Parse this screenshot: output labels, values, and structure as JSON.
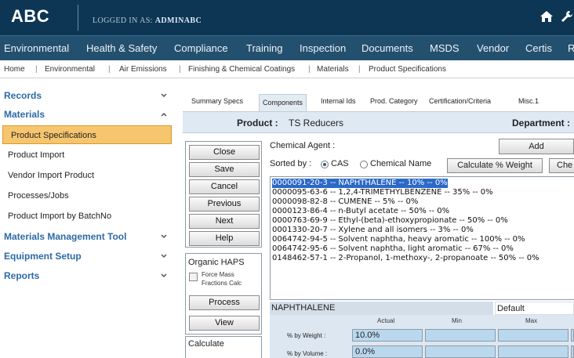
{
  "header": {
    "logo": "ABC",
    "logged_label": "LOGGED IN AS:",
    "logged_user": "ADMINABC"
  },
  "mainnav": {
    "items": [
      "Environmental",
      "Health & Safety",
      "Compliance",
      "Training",
      "Inspection",
      "Documents",
      "MSDS",
      "Vendor",
      "Certis",
      "R"
    ]
  },
  "breadcrumb": {
    "items": [
      "Home",
      "Environmental",
      "Air Emissions",
      "Finishing & Chemical Coatings",
      "Materials",
      "Product Specifications"
    ],
    "separator": "|"
  },
  "sidebar": {
    "records": "Records",
    "materials": "Materials",
    "sub_items": [
      "Product Specifications",
      "Product Import",
      "Vendor Import Product",
      "Processes/Jobs",
      "Product Import by BatchNo"
    ],
    "materials_mgmt": "Materials Management Tool",
    "equipment": "Equipment Setup",
    "reports": "Reports"
  },
  "tabs": [
    "Summary Specs",
    "Components",
    "Internal Ids",
    "Prod. Category",
    "Certification/Criteria",
    "Misc.1"
  ],
  "product": {
    "label": "Product :",
    "value": "TS Reducers",
    "department_label": "Department :"
  },
  "buttons": [
    "Close",
    "Save",
    "Cancel",
    "Previous",
    "Next",
    "Help"
  ],
  "organic_haps": {
    "title": "Organic HAPS",
    "checkbox_label": "Force Mass Fractions Calc",
    "process": "Process",
    "view": "View",
    "calculate": "Calculate"
  },
  "chemical": {
    "label": "Chemical Agent :",
    "add": "Add",
    "sorted_by": "Sorted by :",
    "sort_cas": "CAS",
    "sort_name": "Chemical Name",
    "calc_weight": "Calculate % Weight",
    "che_partial": "Che",
    "list": [
      "0000091-20-3 -- NAPHTHALENE -- 10% -- 0%",
      "0000095-63-6 -- 1,2,4-TRIMETHYLBENZENE -- 35% -- 0%",
      "0000098-82-8 -- CUMENE -- 5% -- 0%",
      "0000123-86-4 -- n-Butyl acetate -- 50% -- 0%",
      "0000763-69-9 -- Ethyl-(beta)-ethoxypropionate -- 50% -- 0%",
      "0001330-20-7 -- Xylene and all isomers -- 3% -- 0%",
      "0064742-94-5 -- Solvent naphtha, heavy aromatic -- 100% -- 0%",
      "0064742-95-6 -- Solvent naphtha, light aromatic -- 67% -- 0%",
      "0148462-57-1 -- 2-Propanol, 1-methoxy-, 2-propanoate -- 50% -- 0%"
    ],
    "selected_index": 0
  },
  "detail": {
    "name": "NAPHTHALENE",
    "default": "Default",
    "col_actual": "Actual",
    "col_min": "Min",
    "col_max": "Max",
    "row_weight": "% by Weight :",
    "row_volume": "% by Volume :",
    "weight_actual": "10.0%",
    "volume_actual": "0.0%"
  },
  "colors": {
    "header_bg": "#0d3655",
    "nav_bg": "#24506f",
    "active_item": "#f6c56e",
    "sidebar_link": "#2c6aa6",
    "selection": "#2b69c8"
  }
}
